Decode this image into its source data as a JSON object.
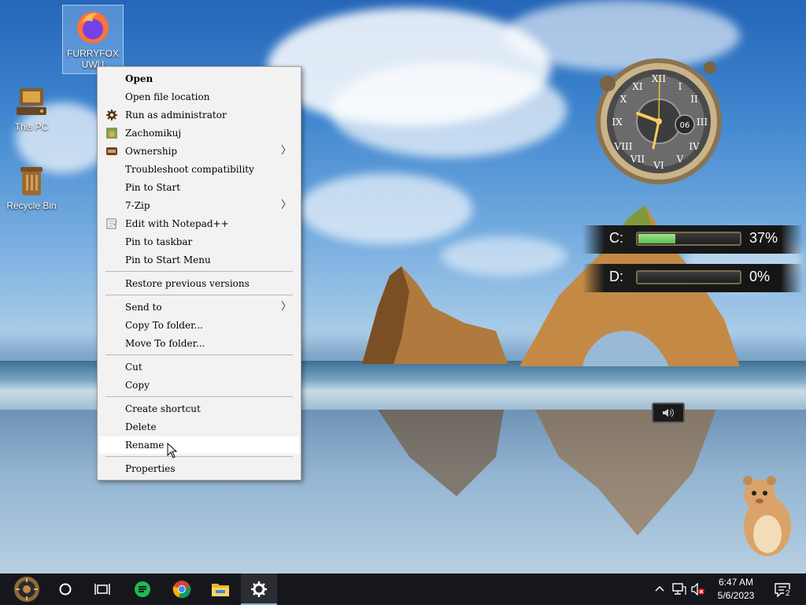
{
  "desktop": {
    "icons": [
      {
        "label_line1": "FURRYFOX",
        "label_line2": "UWU"
      },
      {
        "label": "This PC"
      },
      {
        "label": "Recycle Bin"
      }
    ]
  },
  "context_menu": {
    "open": "Open",
    "open_file_location": "Open file location",
    "run_as_admin": "Run as administrator",
    "zachomikuj": "Zachomikuj",
    "ownership": "Ownership",
    "troubleshoot": "Troubleshoot compatibility",
    "pin_to_start": "Pin to Start",
    "seven_zip": "7-Zip",
    "edit_notepad": "Edit with Notepad++",
    "pin_to_taskbar": "Pin to taskbar",
    "pin_to_start_menu": "Pin to Start Menu",
    "restore_versions": "Restore previous versions",
    "send_to": "Send to",
    "copy_to_folder": "Copy To folder...",
    "move_to_folder": "Move To folder...",
    "cut": "Cut",
    "copy": "Copy",
    "create_shortcut": "Create shortcut",
    "delete": "Delete",
    "rename": "Rename",
    "properties": "Properties"
  },
  "clock_widget": {
    "date_number": "06"
  },
  "drives": [
    {
      "letter": "C:",
      "percent": "37%",
      "fill_fraction": 0.37
    },
    {
      "letter": "D:",
      "percent": "0%",
      "fill_fraction": 0.0
    }
  ],
  "taskbar": {
    "time": "6:47 AM",
    "date": "5/6/2023",
    "notification_count": "2"
  },
  "colors": {
    "menu_bg": "#f2f2f2",
    "taskbar_bg": "#16171c",
    "drive_fill": "#5bbd50",
    "active_indicator": "#7fb4e8"
  }
}
